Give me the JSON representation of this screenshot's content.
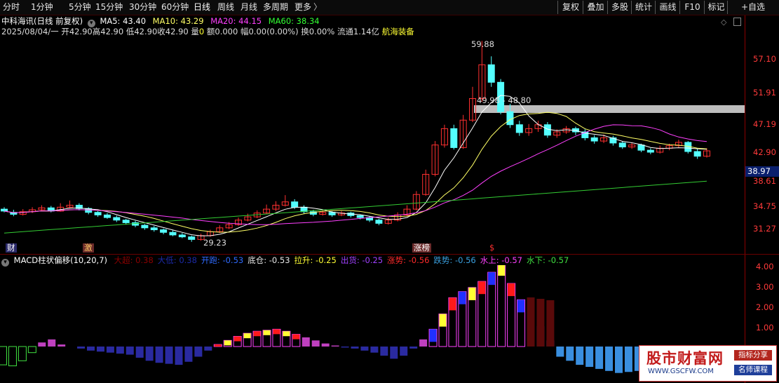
{
  "toolbar": {
    "left_items": [
      "分时",
      "1分钟",
      "5分钟",
      "15分钟",
      "30分钟",
      "60分钟",
      "日线",
      "周线",
      "月线",
      "多周期",
      "更多"
    ],
    "right_items": [
      "复权",
      "叠加",
      "多股",
      "统计",
      "画线",
      "F10",
      "标记",
      "+自选"
    ],
    "more_chevron": "〉"
  },
  "header": {
    "title": "中科海讯(日线 前复权)",
    "ma5": "MA5: 43.40",
    "ma10": "MA10: 43.29",
    "ma20": "MA20: 44.15",
    "ma60": "MA60: 38.34",
    "date": "2025/08/04/一",
    "open": "开42.90",
    "high": "高42.90",
    "low": "低42.90",
    "close": "收42.90",
    "vol_label": "量",
    "vol": "0",
    "amount": "额0.000",
    "change": "幅0.00(0.00%)",
    "turnover": "换0.00%",
    "float_cap": "流通1.14亿",
    "sector": "航海装备"
  },
  "price_axis": [
    "57.10",
    "51.91",
    "47.19",
    "42.90",
    "38.61",
    "34.75",
    "31.27"
  ],
  "current_price": "38.97",
  "annotations": {
    "high": "59.88",
    "low": "29.23",
    "range": "49.98 - 48.80"
  },
  "event_tags": {
    "cai": "财",
    "ji": "激",
    "zhangbang": "涨榜",
    "dollar": "$"
  },
  "macd": {
    "title": "MACD柱状偏移(10,20,7)",
    "items": [
      {
        "label": "大超: 0.38",
        "color": "#8b0000"
      },
      {
        "label": "大低: 0.38",
        "color": "#1c2aa8"
      },
      {
        "label": "开跑: -0.53",
        "color": "#2f6bff"
      },
      {
        "label": "底仓: -0.53",
        "color": "#e8e8e8"
      },
      {
        "label": "拉升: -0.25",
        "color": "#ffff33"
      },
      {
        "label": "出货: -0.25",
        "color": "#a040ff"
      },
      {
        "label": "涨势: -0.56",
        "color": "#ff2a2a"
      },
      {
        "label": "跌势: -0.56",
        "color": "#3aa0e0"
      },
      {
        "label": "水上: -0.57",
        "color": "#ff40ff"
      },
      {
        "label": "水下: -0.57",
        "color": "#40e040"
      }
    ],
    "axis": [
      "4.00",
      "3.00",
      "2.00",
      "1.00"
    ]
  },
  "watermark": {
    "brand": "股市财富网",
    "url": "WWW.GSCFW.COM",
    "badge1": "指标分享",
    "badge2": "名师课程"
  },
  "colors": {
    "up": "#ff3030",
    "down": "#54ffff",
    "ma5": "#ffffff",
    "ma10": "#ffff66",
    "ma20": "#ff40ff",
    "ma60": "#33cc33"
  }
}
